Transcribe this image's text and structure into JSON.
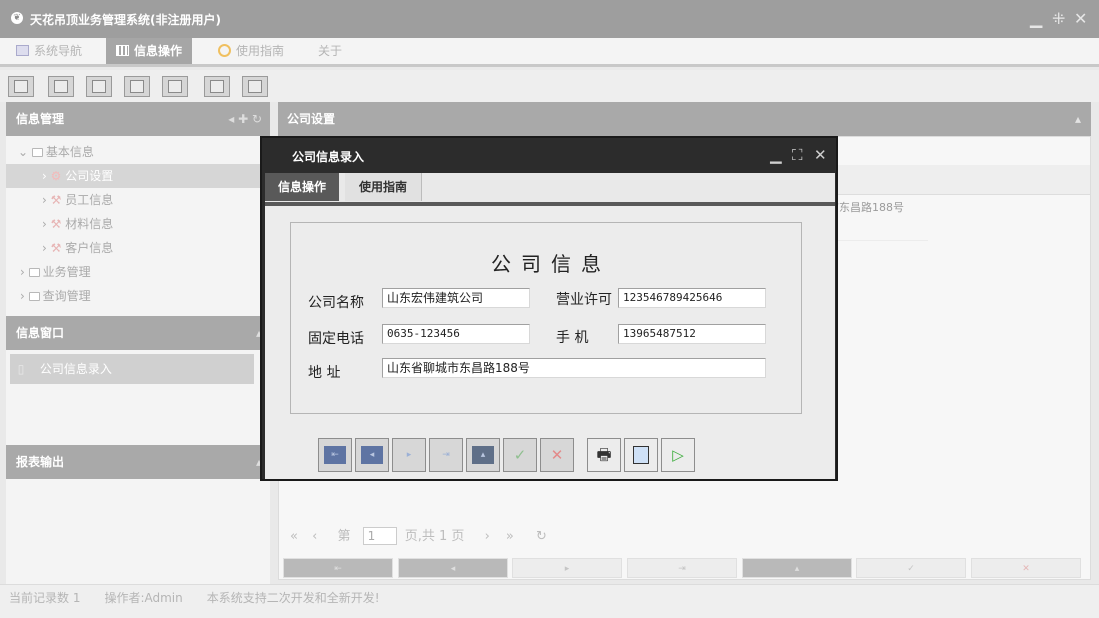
{
  "app": {
    "title": "天花吊顶业务管理系统(非注册用户)",
    "window_controls": [
      "minimize",
      "maximize",
      "close"
    ]
  },
  "menu": {
    "tabs": [
      {
        "label": "系统导航",
        "icon": "monitor-icon"
      },
      {
        "label": "信息操作",
        "icon": "grid-icon",
        "active": true
      },
      {
        "label": "使用指南",
        "icon": "circle-icon"
      },
      {
        "label": "关于"
      }
    ]
  },
  "left": {
    "info_mgmt": {
      "header": "信息管理",
      "items": [
        {
          "label": "基本信息",
          "level": 0,
          "expanded": true
        },
        {
          "label": "公司设置",
          "level": 1,
          "selected": true
        },
        {
          "label": "员工信息",
          "level": 1
        },
        {
          "label": "材料信息",
          "level": 1
        },
        {
          "label": "客户信息",
          "level": 1
        },
        {
          "label": "业务管理",
          "level": 0
        },
        {
          "label": "查询管理",
          "level": 0
        }
      ]
    },
    "info_window": {
      "header": "信息窗口",
      "item": "公司信息录入"
    },
    "report_output": {
      "header": "报表输出"
    }
  },
  "right": {
    "header": "公司设置",
    "bg_cell": "市东昌路188号",
    "pager": {
      "page_label": "第",
      "page_value": "1",
      "total_label": "页,共 1 页"
    }
  },
  "status": {
    "record_count": "当前记录数 1",
    "operator": "操作者:Admin",
    "notice": "本系统支持二次开发和全新开发!"
  },
  "dialog": {
    "title": "公司信息录入",
    "tabs": [
      "信息操作",
      "使用指南"
    ],
    "heading": "公司信息",
    "fields": {
      "company_name": {
        "label": "公司名称",
        "value": "山东宏伟建筑公司"
      },
      "business_license": {
        "label": "营业许可",
        "value": "123546789425646"
      },
      "phone": {
        "label": "固定电话",
        "value": "0635-123456"
      },
      "mobile": {
        "label": "手 机",
        "value": "13965487512"
      },
      "address": {
        "label": "地 址",
        "value": "山东省聊城市东昌路188号"
      }
    },
    "buttons": [
      "first-record",
      "previous-record",
      "next-record",
      "last-record",
      "edit",
      "confirm",
      "cancel",
      "print",
      "preview",
      "run"
    ]
  },
  "colors": {
    "header_gray": "#a9a9a9",
    "dialog_dark": "#2c2c2c",
    "nav_blue": "#5e74a3"
  }
}
